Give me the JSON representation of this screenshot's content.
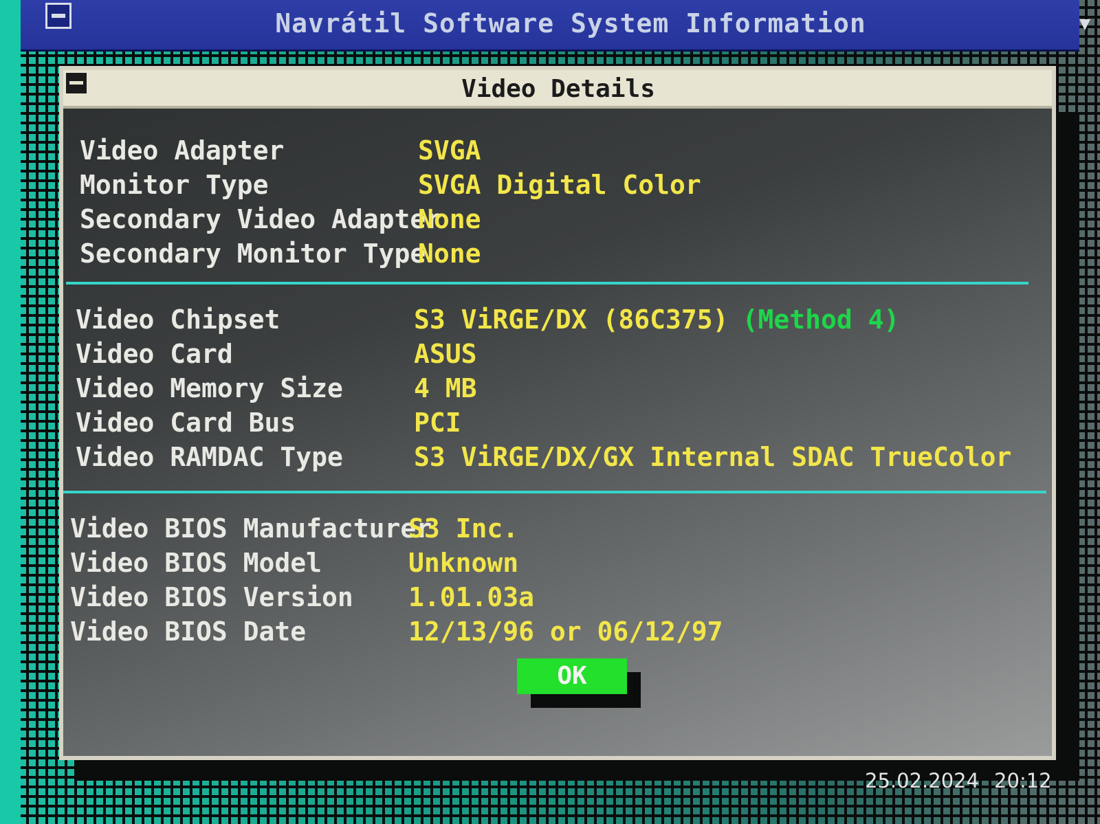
{
  "app": {
    "title": "Navrátil Software System Information"
  },
  "dialog": {
    "title": "Video Details",
    "sections": [
      {
        "rows": [
          {
            "label": "Video Adapter",
            "value": "SVGA"
          },
          {
            "label": "Monitor Type",
            "value": "SVGA Digital Color"
          },
          {
            "label": "Secondary Video Adapter",
            "value": "None"
          },
          {
            "label": "Secondary Monitor Type",
            "value": "None"
          }
        ]
      },
      {
        "rows": [
          {
            "label": "Video Chipset",
            "value": "S3 ViRGE/DX (86C375)",
            "note": "(Method 4)"
          },
          {
            "label": "Video Card",
            "value": "ASUS"
          },
          {
            "label": "Video Memory Size",
            "value": "4 MB"
          },
          {
            "label": "Video Card Bus",
            "value": "PCI"
          },
          {
            "label": "Video RAMDAC Type",
            "value": "S3 ViRGE/DX/GX Internal SDAC TrueColor"
          }
        ]
      },
      {
        "rows": [
          {
            "label": "Video BIOS Manufacturer",
            "value": "S3 Inc."
          },
          {
            "label": "Video BIOS Model",
            "value": "Unknown"
          },
          {
            "label": "Video BIOS Version",
            "value": "1.01.03a"
          },
          {
            "label": "Video BIOS Date",
            "value": "12/13/96 or 06/12/97"
          }
        ]
      }
    ],
    "ok_label": "OK"
  },
  "photo_timestamp": {
    "date": "25.02.2024",
    "time": "20:12"
  },
  "colors": {
    "label_text": "#e9e9e4",
    "value_text": "#f2e64a",
    "method_text": "#1ed64a",
    "divider": "#35d6c8",
    "ok_button": "#22e02c",
    "app_titlebar": "#2f3ea8",
    "dialog_titlebar": "#e8e4d2"
  }
}
